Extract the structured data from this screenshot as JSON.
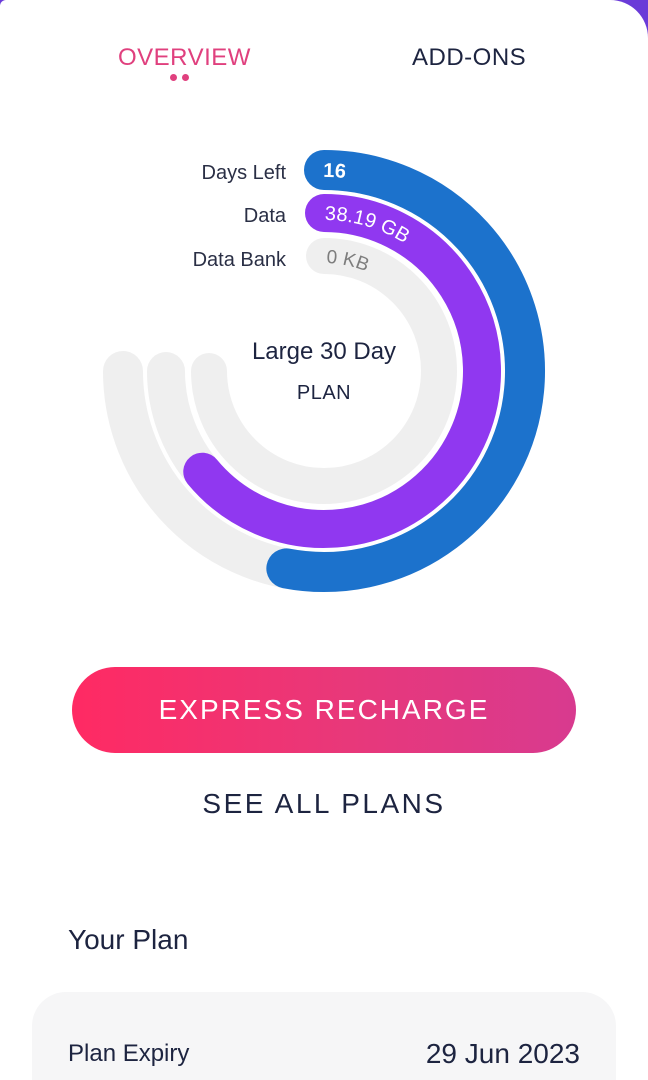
{
  "tabs": [
    {
      "label": "OVERVIEW",
      "active": true
    },
    {
      "label": "ADD-ONS",
      "active": false
    }
  ],
  "usage": {
    "rings": [
      {
        "label": "Days Left",
        "value": "16",
        "fraction": 0.53,
        "color": "#1c72cc"
      },
      {
        "label": "Data",
        "value": "38.19 GB",
        "fraction": 0.64,
        "color": "#9038f0"
      },
      {
        "label": "Data Bank",
        "value": "0 KB",
        "fraction": 0,
        "color": "#efefef"
      }
    ],
    "plan_name": "Large 30 Day",
    "plan_type": "PLAN"
  },
  "actions": {
    "express_recharge": "EXPRESS RECHARGE",
    "see_all_plans": "SEE ALL PLANS"
  },
  "your_plan": {
    "title": "Your Plan",
    "rows": [
      {
        "label": "Plan Expiry",
        "value": "29 Jun 2023"
      }
    ]
  },
  "colors": {
    "accent": "#e0407e",
    "track": "#efefef",
    "text": "#1d2440"
  }
}
